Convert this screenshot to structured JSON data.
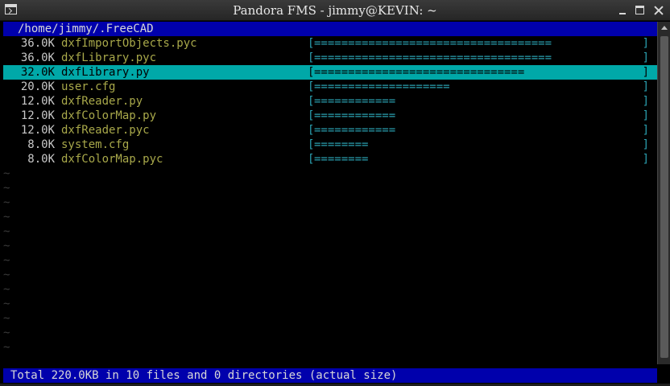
{
  "window": {
    "title": "Pandora FMS - jimmy@KEVIN: ~"
  },
  "ncdu": {
    "path": "/home/jimmy/.FreeCAD",
    "rows": [
      {
        "size": "36.0K",
        "name": "dxfImportObjects.pyc",
        "bar": "===================================",
        "selected": false
      },
      {
        "size": "36.0K",
        "name": "dxfLibrary.pyc",
        "bar": "===================================",
        "selected": false
      },
      {
        "size": "32.0K",
        "name": "dxfLibrary.py",
        "bar": "===============================",
        "selected": true
      },
      {
        "size": "20.0K",
        "name": "user.cfg",
        "bar": "====================",
        "selected": false
      },
      {
        "size": "12.0K",
        "name": "dxfReader.py",
        "bar": "============",
        "selected": false
      },
      {
        "size": "12.0K",
        "name": "dxfColorMap.py",
        "bar": "============",
        "selected": false
      },
      {
        "size": "12.0K",
        "name": "dxfReader.pyc",
        "bar": "============",
        "selected": false
      },
      {
        "size": "8.0K",
        "name": "system.cfg",
        "bar": "========",
        "selected": false
      },
      {
        "size": "8.0K",
        "name": "dxfColorMap.pyc",
        "bar": "========",
        "selected": false
      }
    ],
    "bar_left": "[",
    "bar_right": "]",
    "empty_marker": "~",
    "status": "Total 220.0KB in 10 files and 0 directories (actual size)"
  },
  "colors": {
    "highlight": "#00a8a8",
    "header_bg": "#0000ac",
    "filename": "#a8a84a",
    "bar": "#2aa0b0"
  }
}
